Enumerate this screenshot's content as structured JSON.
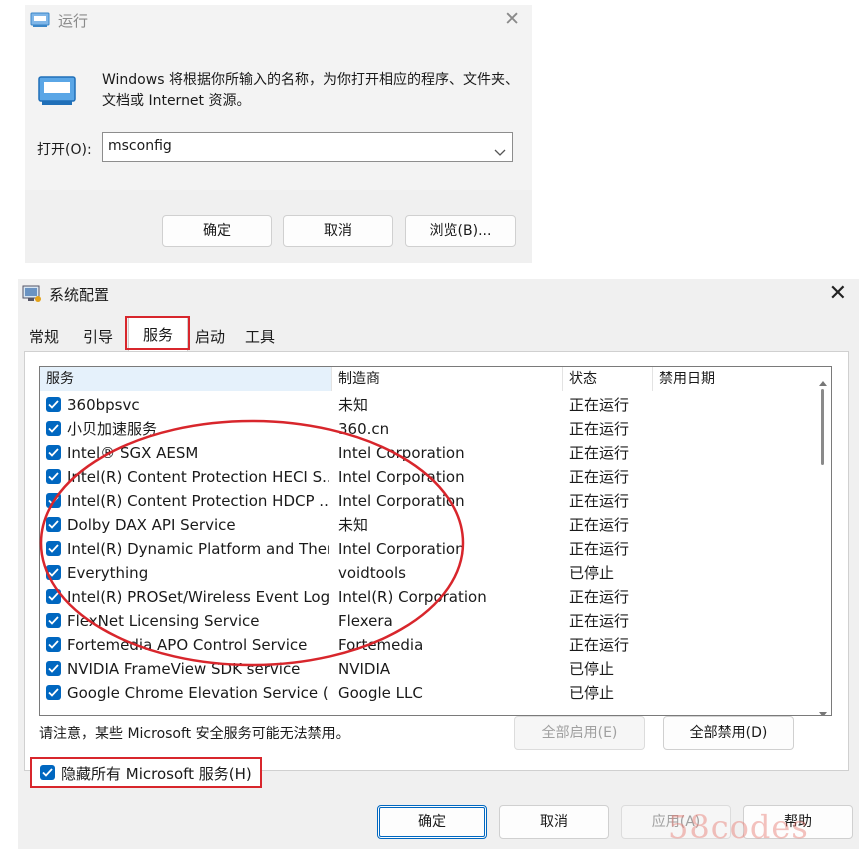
{
  "run_dialog": {
    "title": "运行",
    "description": "Windows 将根据你所输入的名称，为你打开相应的程序、文件夹、文档或 Internet 资源。",
    "open_label": "打开(O):",
    "command_value": "msconfig",
    "ok_label": "确定",
    "cancel_label": "取消",
    "browse_label": "浏览(B)..."
  },
  "msconfig": {
    "title": "系统配置",
    "tabs": [
      "常规",
      "引导",
      "服务",
      "启动",
      "工具"
    ],
    "active_tab": "服务",
    "columns": [
      "服务",
      "制造商",
      "状态",
      "禁用日期"
    ],
    "rows": [
      {
        "name": "360bpsvc",
        "maker": "未知",
        "status": "正在运行",
        "date": ""
      },
      {
        "name": "小贝加速服务",
        "maker": "360.cn",
        "status": "正在运行",
        "date": ""
      },
      {
        "name": "Intel® SGX AESM",
        "maker": "Intel Corporation",
        "status": "正在运行",
        "date": ""
      },
      {
        "name": "Intel(R) Content Protection HECI S...",
        "maker": "Intel Corporation",
        "status": "正在运行",
        "date": ""
      },
      {
        "name": "Intel(R) Content Protection HDCP ...",
        "maker": "Intel Corporation",
        "status": "正在运行",
        "date": ""
      },
      {
        "name": "Dolby DAX API Service",
        "maker": "未知",
        "status": "正在运行",
        "date": ""
      },
      {
        "name": "Intel(R) Dynamic Platform and Ther...",
        "maker": "Intel Corporation",
        "status": "正在运行",
        "date": ""
      },
      {
        "name": "Everything",
        "maker": "voidtools",
        "status": "已停止",
        "date": ""
      },
      {
        "name": "Intel(R) PROSet/Wireless Event Log",
        "maker": "Intel(R) Corporation",
        "status": "正在运行",
        "date": ""
      },
      {
        "name": "FlexNet Licensing Service",
        "maker": "Flexera",
        "status": "正在运行",
        "date": ""
      },
      {
        "name": "Fortemedia APO Control Service",
        "maker": "Fortemedia",
        "status": "正在运行",
        "date": ""
      },
      {
        "name": "NVIDIA FrameView SDK service",
        "maker": "NVIDIA",
        "status": "已停止",
        "date": ""
      },
      {
        "name": "Google Chrome Elevation Service (...",
        "maker": "Google LLC",
        "status": "已停止",
        "date": ""
      }
    ],
    "note": "请注意，某些 Microsoft 安全服务可能无法禁用。",
    "enable_all_label": "全部启用(E)",
    "disable_all_label": "全部禁用(D)",
    "hide_ms_label": "隐藏所有 Microsoft 服务(H)",
    "hide_ms_checked": true,
    "ok_label": "确定",
    "cancel_label": "取消",
    "apply_label": "应用(A)",
    "help_label": "帮助"
  },
  "watermark": "58codes",
  "colors": {
    "accent": "#0067c0",
    "highlight": "#d8262c"
  }
}
